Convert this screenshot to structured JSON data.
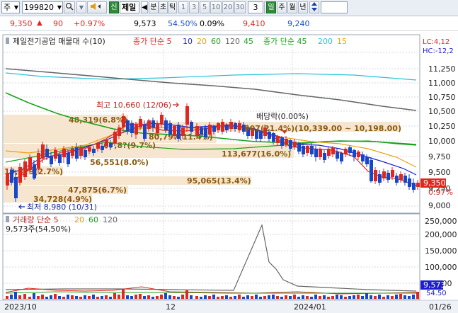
{
  "toolbar": {
    "market_label": "주",
    "stock_code": "199820",
    "search_icon": "magnifier-icon",
    "speaker_icon": "speaker-icon",
    "new_label": "신",
    "company_short": "제일",
    "tick_prev": "◀",
    "minute_label": "분",
    "tick_label": "초",
    "tick_label2": "틱",
    "intervals": [
      "1",
      "3",
      "5",
      "10",
      "20",
      "30"
    ],
    "selected_interval": "3",
    "day_label": "일",
    "week_label": "주",
    "month_label": "월",
    "year_label": "년",
    "updown_icon": "updown-arrows-icon"
  },
  "quote": {
    "price": "9,350",
    "change_arrow": "▲",
    "change": "90",
    "change_pct": "+0.97%",
    "volume": "9,573",
    "vol_ratio": "54.50%",
    "turnover": "0.09%",
    "high": "9,410",
    "low": "9,240"
  },
  "legend": {
    "title": "제일전기공업 매물대 수(10)",
    "ma1_label": "종가 단순 5",
    "ma1_periods": [
      "10",
      "20",
      "60",
      "120",
      "45"
    ],
    "ma2_label": "종가 단순 45",
    "ma2_periods": [
      "200",
      "15"
    ],
    "lc": "LC:4,12",
    "hc": "HC:-12,2"
  },
  "price_axis": [
    "11,250",
    "11,000",
    "10,750",
    "10,500",
    "10,250",
    "10,000",
    "9,750",
    "9,500",
    "9,250",
    "9,000"
  ],
  "price_tag": "9,350",
  "pct_tag": "0.97%",
  "annotations": {
    "high": "최고 10,660 (12/06)",
    "low": "최저 8,980 (10/31)",
    "dividend": "배당락(0.00%)",
    "range": "907(21.4%)(10,339.00 ~ 10,198.00)"
  },
  "profile_labels": [
    "48,319(6.8%)",
    "80,797(11.4%)",
    "56,551(8.0%)",
    "113,677(16.0%)",
    "95,065(13.4%)",
    "47,875(6.7%)",
    "19,379(2.7%)",
    "34,728(4.9%)",
    "67,8?(9.7%)"
  ],
  "volume_pane": {
    "title": "거래량 단순 5",
    "periods": [
      "20",
      "60",
      "120"
    ],
    "current": "9,573주(54,50%)",
    "axis": [
      "250,000",
      "200,000",
      "150,000",
      "100,000",
      "50,000"
    ],
    "vol_tag": "9,573",
    "vol_pct_tag": "54.50"
  },
  "date_axis": [
    "2023/10",
    "12",
    "2024/01",
    "01/26"
  ],
  "colors": {
    "up": "#e0271f",
    "down": "#1747c8",
    "ma5": "#e0271f",
    "ma10": "#1e1ecc",
    "ma20": "#e8a010",
    "ma60": "#1aa21a",
    "ma120": "#666666",
    "ma200": "#27c3d8",
    "profile": "#f6e6cf"
  }
}
